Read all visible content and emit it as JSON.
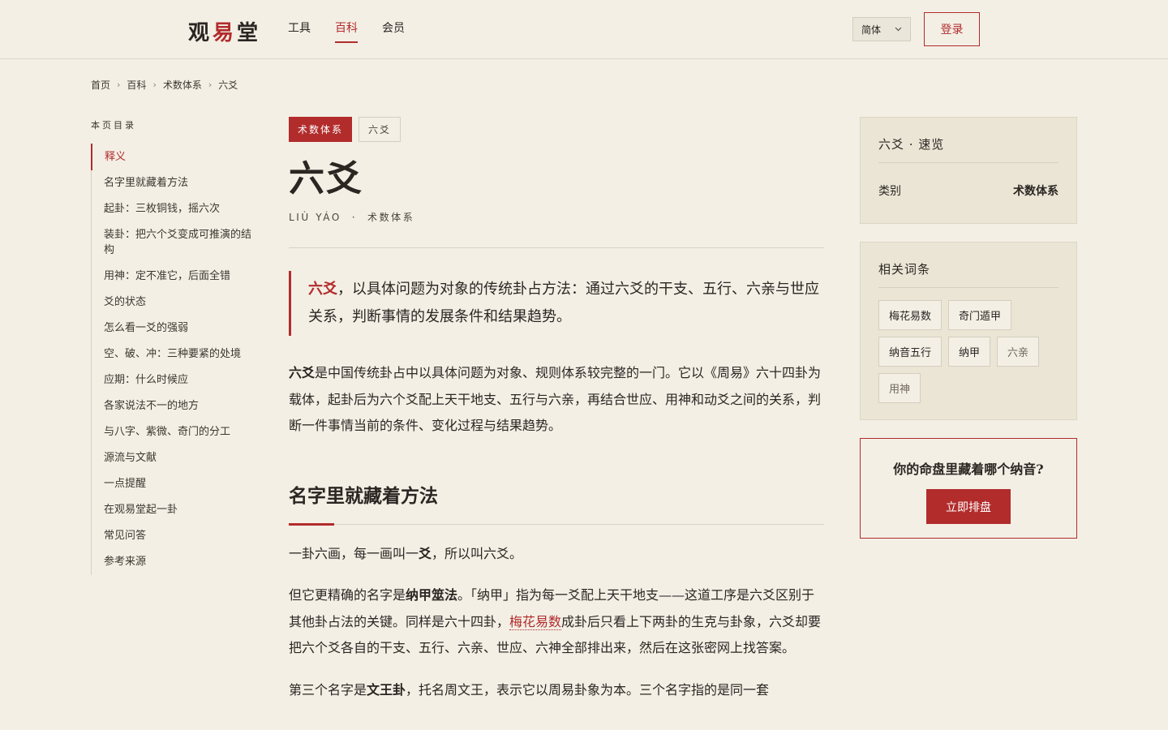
{
  "header": {
    "logo": [
      "观",
      "易",
      "堂"
    ],
    "nav": [
      {
        "label": "工具",
        "active": false
      },
      {
        "label": "百科",
        "active": true
      },
      {
        "label": "会员",
        "active": false
      }
    ],
    "lang": "简体",
    "login": "登录"
  },
  "breadcrumb": [
    "首页",
    "百科",
    "术数体系",
    "六爻"
  ],
  "toc": {
    "title": "本页目录",
    "items": [
      "释义",
      "名字里就藏着方法",
      "起卦：三枚铜钱，摇六次",
      "装卦：把六个爻变成可推演的结构",
      "用神：定不准它，后面全错",
      "爻的状态",
      "怎么看一爻的强弱",
      "空、破、冲：三种要紧的处境",
      "应期：什么时候应",
      "各家说法不一的地方",
      "与八字、紫微、奇门的分工",
      "源流与文献",
      "一点提醒",
      "在观易堂起一卦",
      "常见问答",
      "参考来源"
    ]
  },
  "article": {
    "tag_category": "术数体系",
    "tag_term": "六爻",
    "title": "六爻",
    "pinyin": "LIÙ YÁO",
    "subtitle_dot": "·",
    "subtitle_category": "术数体系",
    "lead_term": "六爻",
    "lead_rest": "，以具体问题为对象的传统卦占方法：通过六爻的干支、五行、六亲与世应关系，判断事情的发展条件和结果趋势。",
    "p1_bold": "六爻",
    "p1_rest": "是中国传统卦占中以具体问题为对象、规则体系较完整的一门。它以《周易》六十四卦为载体，起卦后为六个爻配上天干地支、五行与六亲，再结合世应、用神和动爻之间的关系，判断一件事情当前的条件、变化过程与结果趋势。",
    "h2": "名字里就藏着方法",
    "p2_a": "一卦六画，每一画叫一",
    "p2_bold": "爻",
    "p2_b": "，所以叫六爻。",
    "p3_a": "但它更精确的名字是",
    "p3_bold": "纳甲筮法",
    "p3_b": "。「纳甲」指为每一爻配上天干地支——这道工序是六爻区别于其他卦占法的关键。同样是六十四卦，",
    "p3_link": "梅花易数",
    "p3_c": "成卦后只看上下两卦的生克与卦象，六爻却要把六个爻各自的干支、五行、六亲、世应、六神全部排出来，然后在这张密网上找答案。",
    "p4_a": "第三个名字是",
    "p4_bold": "文王卦",
    "p4_b": "，托名周文王，表示它以周易卦象为本。三个名字指的是同一套"
  },
  "summary": {
    "title": "六爻 · 速览",
    "label": "类别",
    "value": "术数体系"
  },
  "related": {
    "title": "相关词条",
    "chips": [
      "梅花易数",
      "奇门遁甲",
      "纳音五行",
      "纳甲",
      "六亲",
      "用神"
    ]
  },
  "cta": {
    "text": "你的命盘里藏着哪个纳音?",
    "button": "立即排盘"
  },
  "colors": {
    "accent": "#b22c2c",
    "background": "#f3efe5",
    "card": "#ebe5d6"
  }
}
